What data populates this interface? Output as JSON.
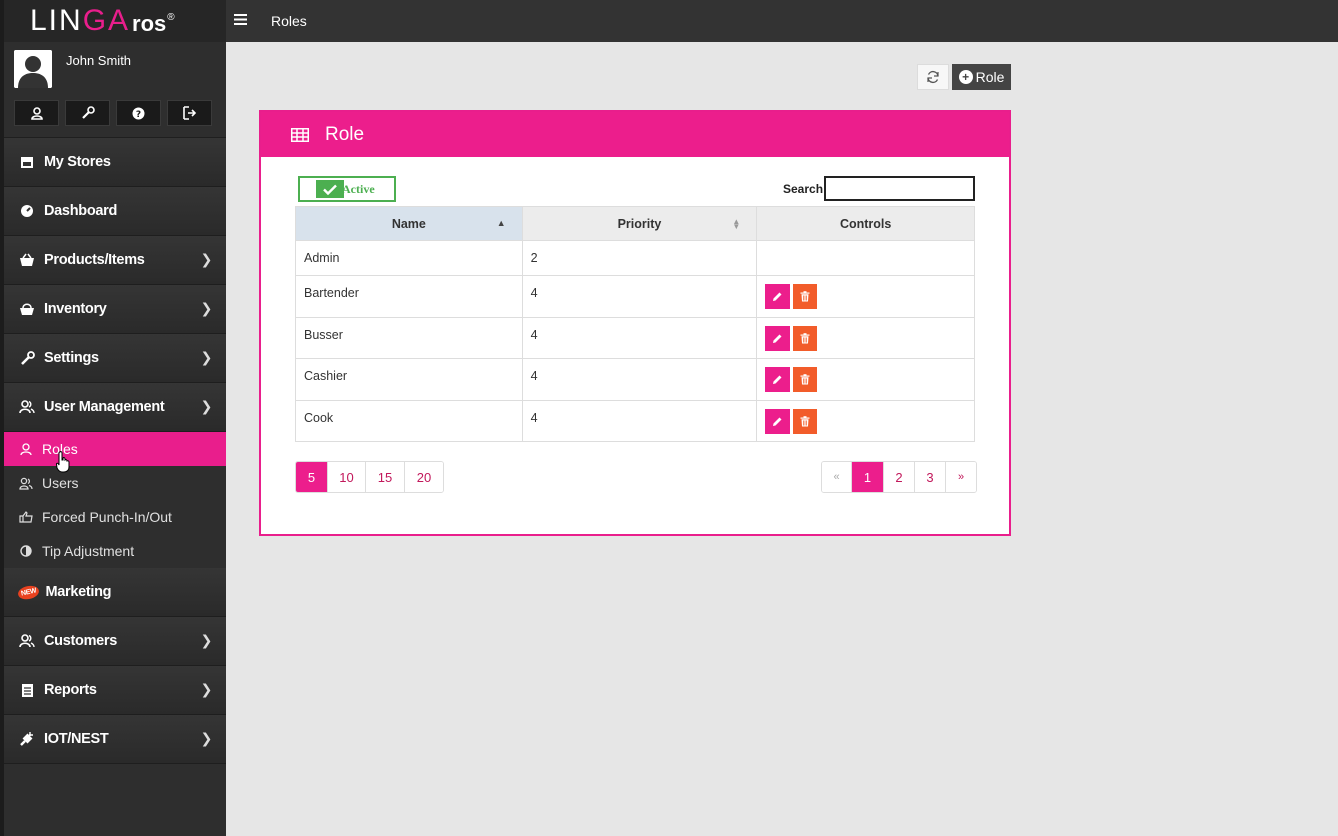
{
  "brand": {
    "logo_main": "LIN",
    "logo_accent": "GA",
    "logo_sub": "ros",
    "logo_reg": "®"
  },
  "topbar": {
    "title": "Roles"
  },
  "user": {
    "name": "John Smith"
  },
  "quick_buttons": [
    "user-icon",
    "wrench-icon",
    "help-icon",
    "logout-icon"
  ],
  "nav": {
    "my_stores": "My Stores",
    "dashboard": "Dashboard",
    "products": "Products/Items",
    "inventory": "Inventory",
    "settings": "Settings",
    "user_management": "User Management",
    "sub": {
      "roles": "Roles",
      "users": "Users",
      "forced_punch": "Forced Punch-In/Out",
      "tip_adjustment": "Tip Adjustment"
    },
    "marketing": "Marketing",
    "marketing_badge": "NEW",
    "customers": "Customers",
    "reports": "Reports",
    "iot": "IOT/NEST"
  },
  "actions": {
    "add_role": "Role"
  },
  "panel": {
    "title": "Role",
    "toggle_label": "Active",
    "search_label": "Search",
    "search_value": ""
  },
  "table": {
    "headers": {
      "name": "Name",
      "priority": "Priority",
      "controls": "Controls"
    },
    "rows": [
      {
        "name": "Admin",
        "priority": "2"
      },
      {
        "name": "Bartender",
        "priority": "4"
      },
      {
        "name": "Busser",
        "priority": "4"
      },
      {
        "name": "Cashier",
        "priority": "4"
      },
      {
        "name": "Cook",
        "priority": "4"
      }
    ]
  },
  "pagination": {
    "sizes": [
      "5",
      "10",
      "15",
      "20"
    ],
    "selected_size": "5",
    "prev": "«",
    "pages": [
      "1",
      "2",
      "3"
    ],
    "current_page": "1",
    "next": "»"
  },
  "colors": {
    "accent": "#ec1e8c",
    "delete": "#f25c2a",
    "active_green": "#4caf50",
    "sidebar": "#2e2e2e"
  }
}
